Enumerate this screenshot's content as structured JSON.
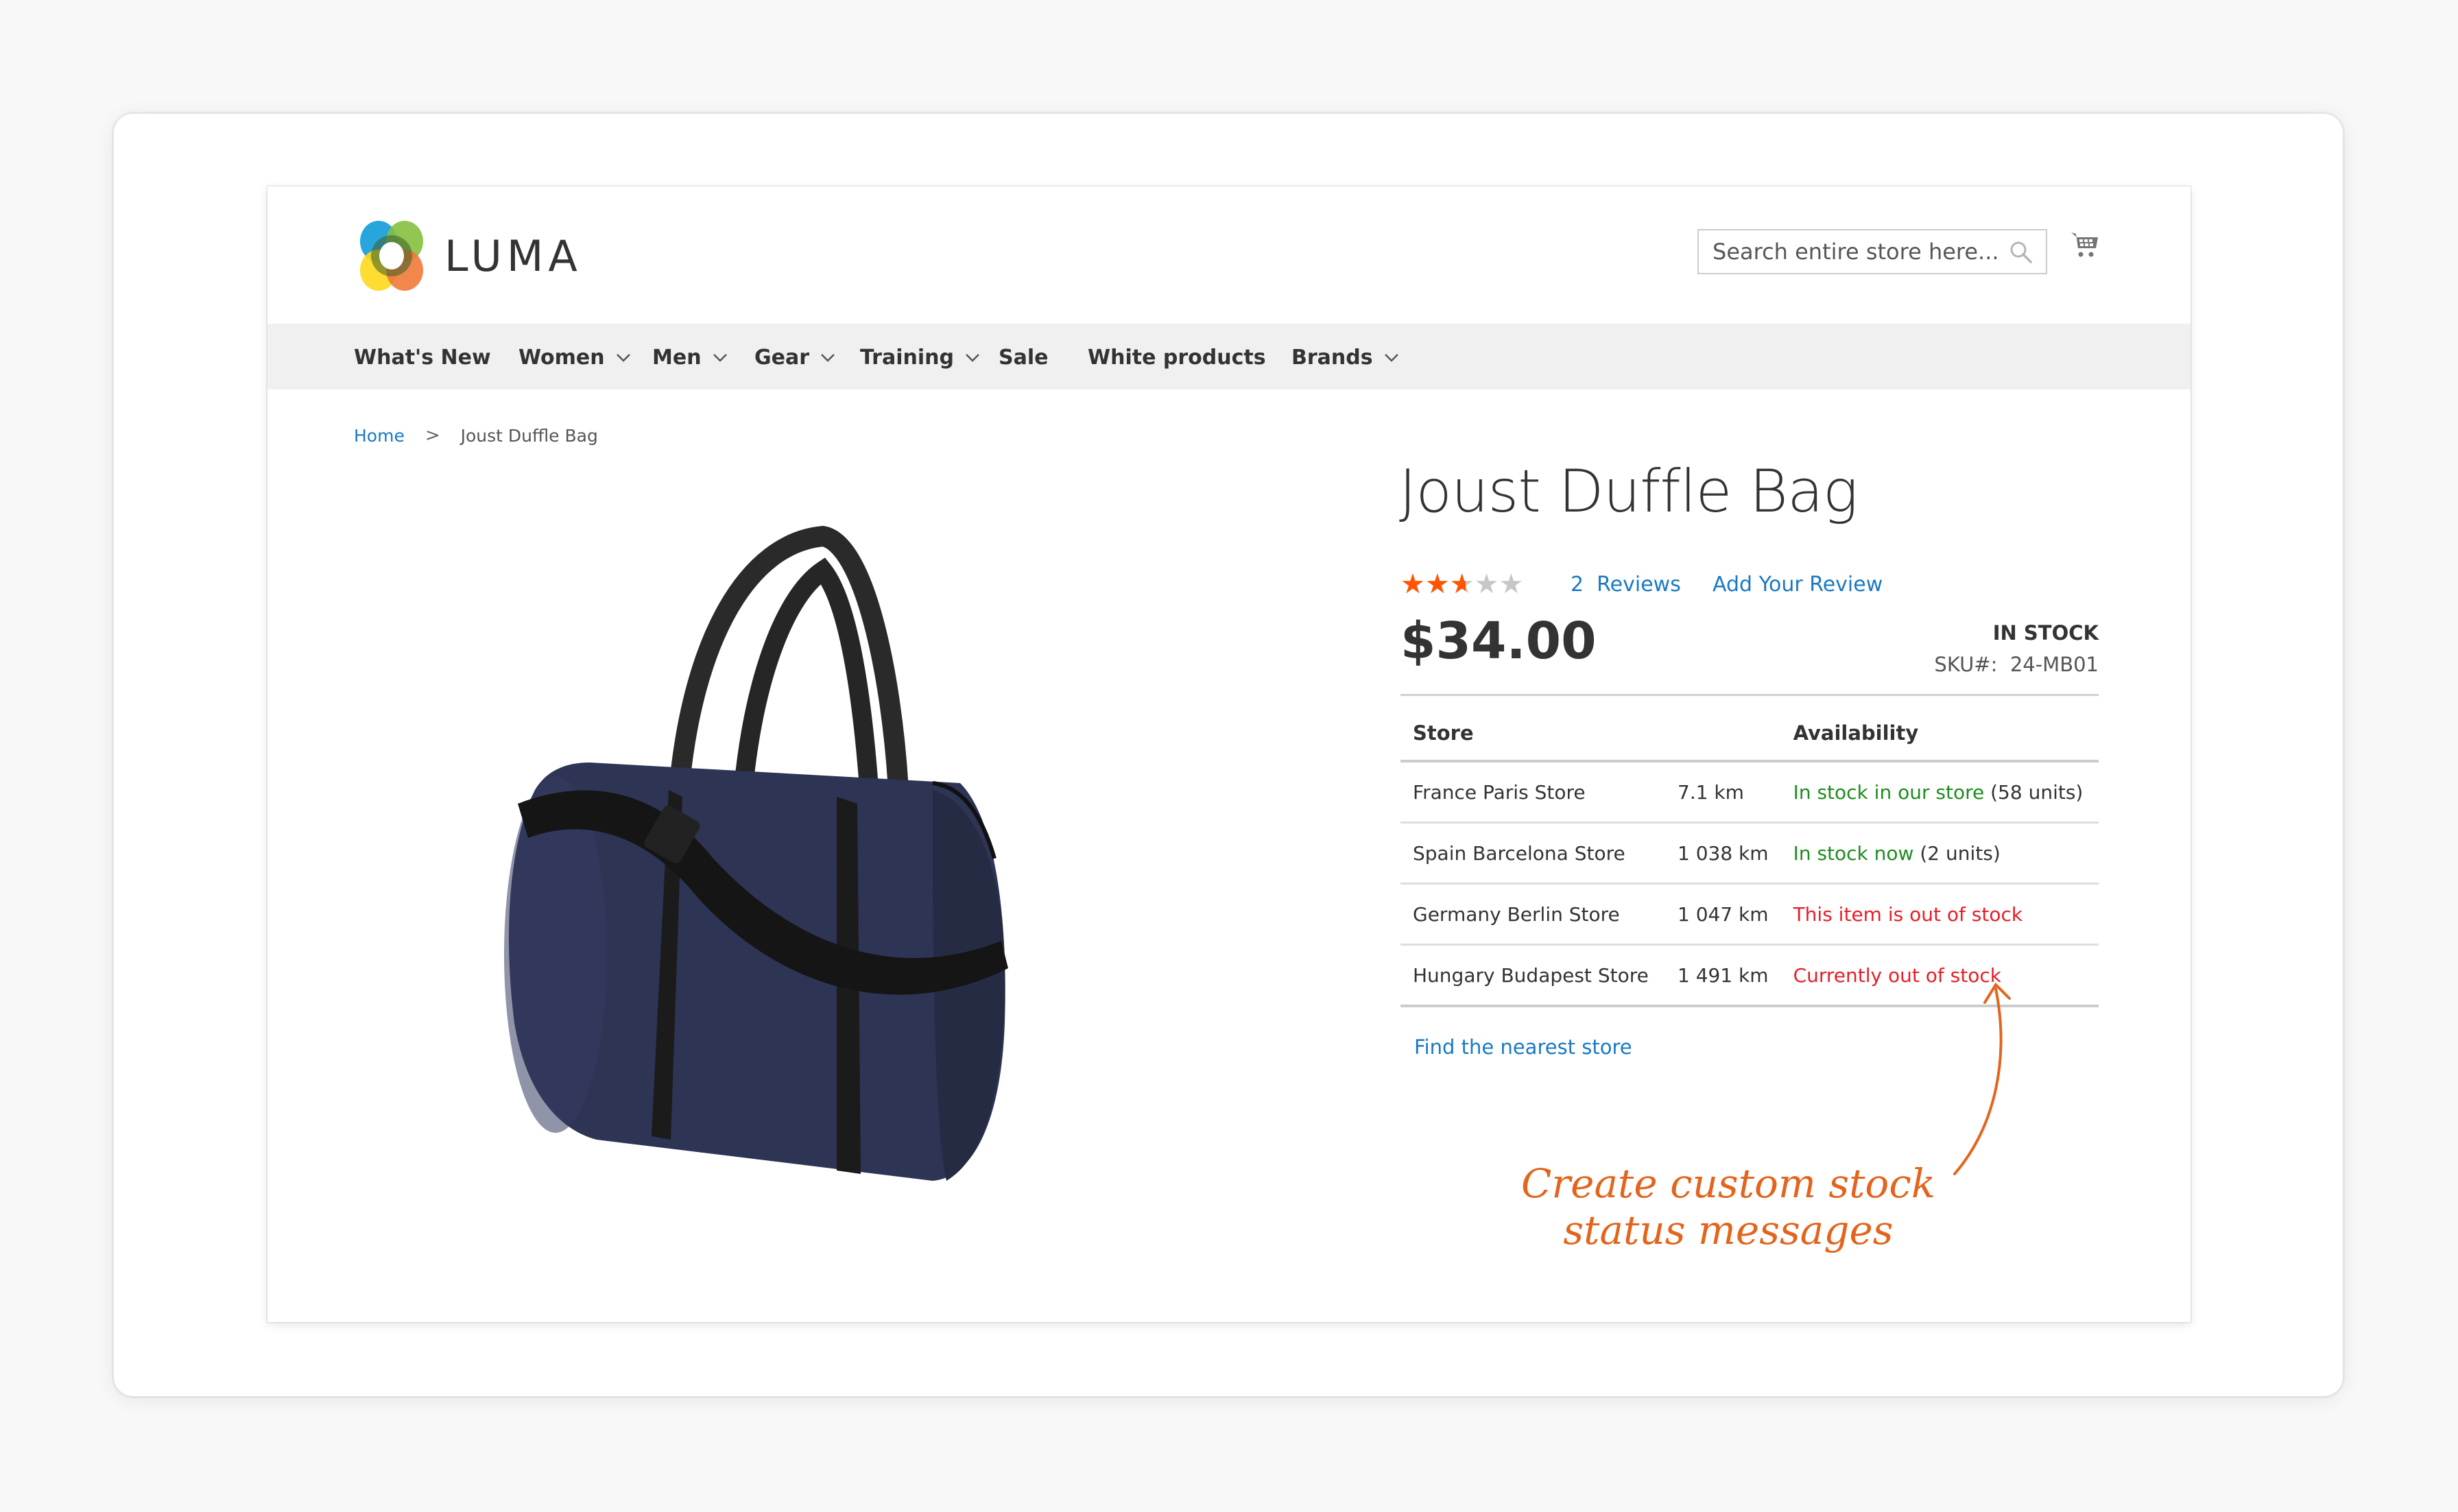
{
  "header": {
    "logo_text": "LUMA",
    "search_placeholder": "Search entire store here...",
    "search_icon": "search-icon",
    "cart_icon": "cart-icon"
  },
  "nav": {
    "items": [
      {
        "label": "What's New",
        "has_dropdown": false
      },
      {
        "label": "Women",
        "has_dropdown": true
      },
      {
        "label": "Men",
        "has_dropdown": true
      },
      {
        "label": "Gear",
        "has_dropdown": true
      },
      {
        "label": "Training",
        "has_dropdown": true
      },
      {
        "label": "Sale",
        "has_dropdown": false
      },
      {
        "label": "White products",
        "has_dropdown": false
      },
      {
        "label": "Brands",
        "has_dropdown": true
      }
    ]
  },
  "breadcrumb": {
    "home": "Home",
    "separator": ">",
    "current": "Joust Duffle Bag"
  },
  "product": {
    "title": "Joust Duffle Bag",
    "rating": {
      "value": 2.5,
      "max": 5,
      "fill_percent": 50
    },
    "reviews_count": "2",
    "reviews_label": "Reviews",
    "add_review_label": "Add Your Review",
    "price": "$34.00",
    "stock_status": "IN STOCK",
    "sku_label": "SKU#:",
    "sku_value": "24-MB01",
    "image_alt": "navy duffle bag with black straps"
  },
  "stores_table": {
    "headers": {
      "store": "Store",
      "availability": "Availability"
    },
    "rows": [
      {
        "store": "France Paris Store",
        "distance": "7.1 km",
        "status": "In stock in our store",
        "status_type": "in",
        "units": "(58 units)"
      },
      {
        "store": "Spain Barcelona Store",
        "distance": "1 038 km",
        "status": "In stock now",
        "status_type": "in",
        "units": "(2 units)"
      },
      {
        "store": "Germany Berlin Store",
        "distance": "1 047 km",
        "status": "This item is out of stock",
        "status_type": "out",
        "units": ""
      },
      {
        "store": "Hungary Budapest Store",
        "distance": "1 491 km",
        "status": "Currently out of stock",
        "status_type": "out",
        "units": ""
      }
    ],
    "find_store_label": "Find the nearest store"
  },
  "annotation": {
    "line1": "Create custom stock",
    "line2": "status messages"
  },
  "colors": {
    "link": "#1979c3",
    "in_stock": "#1d8c1d",
    "out_of_stock": "#e61e26",
    "star_filled": "#ff5501",
    "star_empty": "#c7c7c7",
    "annotation": "#e3651d",
    "nav_bg": "#f0f0f0"
  }
}
